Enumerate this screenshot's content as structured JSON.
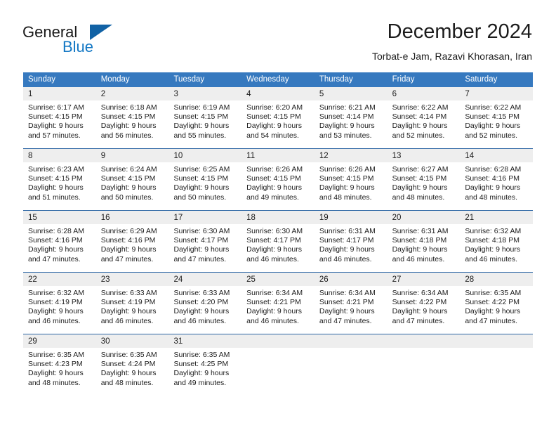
{
  "brand": {
    "line1": "General",
    "line2": "Blue",
    "icon": "triangle-logo"
  },
  "header": {
    "title": "December 2024",
    "subtitle": "Torbat-e Jam, Razavi Khorasan, Iran"
  },
  "colors": {
    "header_blue": "#3679bf",
    "separator_blue": "#2e67a5",
    "day_band_gray": "#eeeeee",
    "brand_blue": "#1277c4",
    "brand_triangle": "#1162a5"
  },
  "weekdays": [
    "Sunday",
    "Monday",
    "Tuesday",
    "Wednesday",
    "Thursday",
    "Friday",
    "Saturday"
  ],
  "weeks": [
    [
      {
        "day": "1",
        "sunrise": "Sunrise: 6:17 AM",
        "sunset": "Sunset: 4:15 PM",
        "daylight1": "Daylight: 9 hours",
        "daylight2": "and 57 minutes."
      },
      {
        "day": "2",
        "sunrise": "Sunrise: 6:18 AM",
        "sunset": "Sunset: 4:15 PM",
        "daylight1": "Daylight: 9 hours",
        "daylight2": "and 56 minutes."
      },
      {
        "day": "3",
        "sunrise": "Sunrise: 6:19 AM",
        "sunset": "Sunset: 4:15 PM",
        "daylight1": "Daylight: 9 hours",
        "daylight2": "and 55 minutes."
      },
      {
        "day": "4",
        "sunrise": "Sunrise: 6:20 AM",
        "sunset": "Sunset: 4:15 PM",
        "daylight1": "Daylight: 9 hours",
        "daylight2": "and 54 minutes."
      },
      {
        "day": "5",
        "sunrise": "Sunrise: 6:21 AM",
        "sunset": "Sunset: 4:14 PM",
        "daylight1": "Daylight: 9 hours",
        "daylight2": "and 53 minutes."
      },
      {
        "day": "6",
        "sunrise": "Sunrise: 6:22 AM",
        "sunset": "Sunset: 4:14 PM",
        "daylight1": "Daylight: 9 hours",
        "daylight2": "and 52 minutes."
      },
      {
        "day": "7",
        "sunrise": "Sunrise: 6:22 AM",
        "sunset": "Sunset: 4:15 PM",
        "daylight1": "Daylight: 9 hours",
        "daylight2": "and 52 minutes."
      }
    ],
    [
      {
        "day": "8",
        "sunrise": "Sunrise: 6:23 AM",
        "sunset": "Sunset: 4:15 PM",
        "daylight1": "Daylight: 9 hours",
        "daylight2": "and 51 minutes."
      },
      {
        "day": "9",
        "sunrise": "Sunrise: 6:24 AM",
        "sunset": "Sunset: 4:15 PM",
        "daylight1": "Daylight: 9 hours",
        "daylight2": "and 50 minutes."
      },
      {
        "day": "10",
        "sunrise": "Sunrise: 6:25 AM",
        "sunset": "Sunset: 4:15 PM",
        "daylight1": "Daylight: 9 hours",
        "daylight2": "and 50 minutes."
      },
      {
        "day": "11",
        "sunrise": "Sunrise: 6:26 AM",
        "sunset": "Sunset: 4:15 PM",
        "daylight1": "Daylight: 9 hours",
        "daylight2": "and 49 minutes."
      },
      {
        "day": "12",
        "sunrise": "Sunrise: 6:26 AM",
        "sunset": "Sunset: 4:15 PM",
        "daylight1": "Daylight: 9 hours",
        "daylight2": "and 48 minutes."
      },
      {
        "day": "13",
        "sunrise": "Sunrise: 6:27 AM",
        "sunset": "Sunset: 4:15 PM",
        "daylight1": "Daylight: 9 hours",
        "daylight2": "and 48 minutes."
      },
      {
        "day": "14",
        "sunrise": "Sunrise: 6:28 AM",
        "sunset": "Sunset: 4:16 PM",
        "daylight1": "Daylight: 9 hours",
        "daylight2": "and 48 minutes."
      }
    ],
    [
      {
        "day": "15",
        "sunrise": "Sunrise: 6:28 AM",
        "sunset": "Sunset: 4:16 PM",
        "daylight1": "Daylight: 9 hours",
        "daylight2": "and 47 minutes."
      },
      {
        "day": "16",
        "sunrise": "Sunrise: 6:29 AM",
        "sunset": "Sunset: 4:16 PM",
        "daylight1": "Daylight: 9 hours",
        "daylight2": "and 47 minutes."
      },
      {
        "day": "17",
        "sunrise": "Sunrise: 6:30 AM",
        "sunset": "Sunset: 4:17 PM",
        "daylight1": "Daylight: 9 hours",
        "daylight2": "and 47 minutes."
      },
      {
        "day": "18",
        "sunrise": "Sunrise: 6:30 AM",
        "sunset": "Sunset: 4:17 PM",
        "daylight1": "Daylight: 9 hours",
        "daylight2": "and 46 minutes."
      },
      {
        "day": "19",
        "sunrise": "Sunrise: 6:31 AM",
        "sunset": "Sunset: 4:17 PM",
        "daylight1": "Daylight: 9 hours",
        "daylight2": "and 46 minutes."
      },
      {
        "day": "20",
        "sunrise": "Sunrise: 6:31 AM",
        "sunset": "Sunset: 4:18 PM",
        "daylight1": "Daylight: 9 hours",
        "daylight2": "and 46 minutes."
      },
      {
        "day": "21",
        "sunrise": "Sunrise: 6:32 AM",
        "sunset": "Sunset: 4:18 PM",
        "daylight1": "Daylight: 9 hours",
        "daylight2": "and 46 minutes."
      }
    ],
    [
      {
        "day": "22",
        "sunrise": "Sunrise: 6:32 AM",
        "sunset": "Sunset: 4:19 PM",
        "daylight1": "Daylight: 9 hours",
        "daylight2": "and 46 minutes."
      },
      {
        "day": "23",
        "sunrise": "Sunrise: 6:33 AM",
        "sunset": "Sunset: 4:19 PM",
        "daylight1": "Daylight: 9 hours",
        "daylight2": "and 46 minutes."
      },
      {
        "day": "24",
        "sunrise": "Sunrise: 6:33 AM",
        "sunset": "Sunset: 4:20 PM",
        "daylight1": "Daylight: 9 hours",
        "daylight2": "and 46 minutes."
      },
      {
        "day": "25",
        "sunrise": "Sunrise: 6:34 AM",
        "sunset": "Sunset: 4:21 PM",
        "daylight1": "Daylight: 9 hours",
        "daylight2": "and 46 minutes."
      },
      {
        "day": "26",
        "sunrise": "Sunrise: 6:34 AM",
        "sunset": "Sunset: 4:21 PM",
        "daylight1": "Daylight: 9 hours",
        "daylight2": "and 47 minutes."
      },
      {
        "day": "27",
        "sunrise": "Sunrise: 6:34 AM",
        "sunset": "Sunset: 4:22 PM",
        "daylight1": "Daylight: 9 hours",
        "daylight2": "and 47 minutes."
      },
      {
        "day": "28",
        "sunrise": "Sunrise: 6:35 AM",
        "sunset": "Sunset: 4:22 PM",
        "daylight1": "Daylight: 9 hours",
        "daylight2": "and 47 minutes."
      }
    ],
    [
      {
        "day": "29",
        "sunrise": "Sunrise: 6:35 AM",
        "sunset": "Sunset: 4:23 PM",
        "daylight1": "Daylight: 9 hours",
        "daylight2": "and 48 minutes."
      },
      {
        "day": "30",
        "sunrise": "Sunrise: 6:35 AM",
        "sunset": "Sunset: 4:24 PM",
        "daylight1": "Daylight: 9 hours",
        "daylight2": "and 48 minutes."
      },
      {
        "day": "31",
        "sunrise": "Sunrise: 6:35 AM",
        "sunset": "Sunset: 4:25 PM",
        "daylight1": "Daylight: 9 hours",
        "daylight2": "and 49 minutes."
      },
      {
        "day": "",
        "sunrise": "",
        "sunset": "",
        "daylight1": "",
        "daylight2": ""
      },
      {
        "day": "",
        "sunrise": "",
        "sunset": "",
        "daylight1": "",
        "daylight2": ""
      },
      {
        "day": "",
        "sunrise": "",
        "sunset": "",
        "daylight1": "",
        "daylight2": ""
      },
      {
        "day": "",
        "sunrise": "",
        "sunset": "",
        "daylight1": "",
        "daylight2": ""
      }
    ]
  ]
}
